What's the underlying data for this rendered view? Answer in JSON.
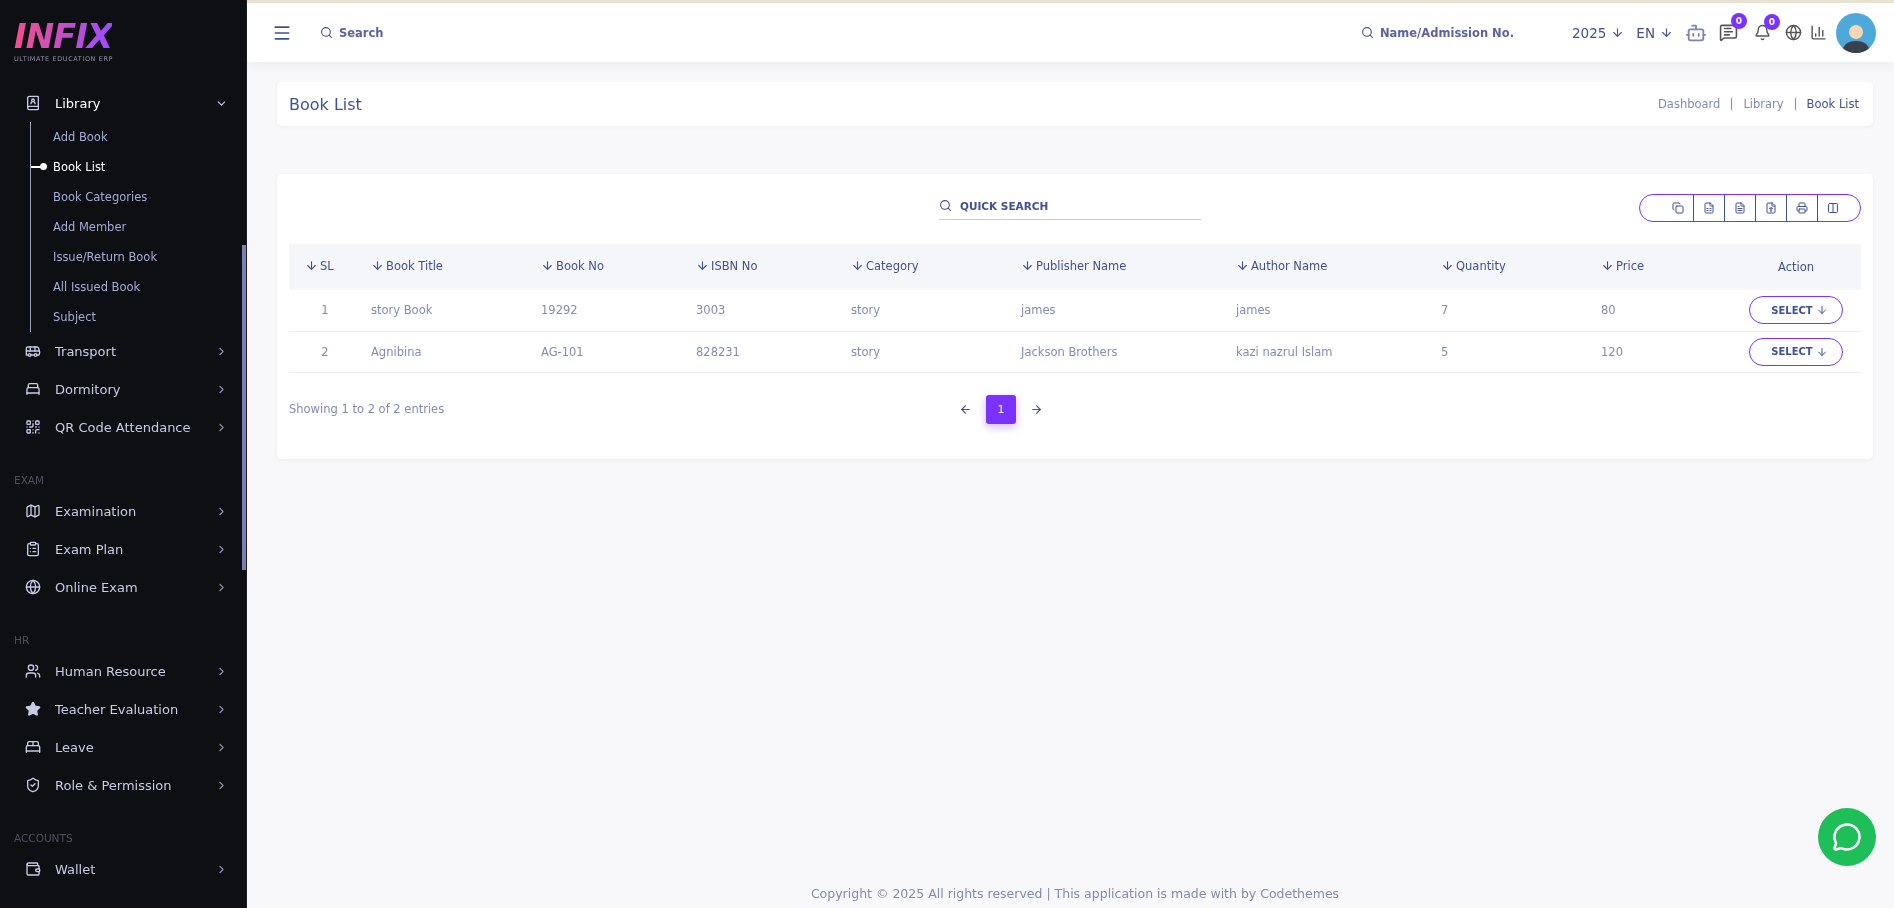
{
  "logo": {
    "name": "INFIX",
    "tagline": "ULTIMATE EDUCATION ERP"
  },
  "sidebar": {
    "sections": [
      {
        "items": [
          {
            "label": "Library",
            "expanded": true,
            "children": [
              {
                "label": "Add Book",
                "selected": false
              },
              {
                "label": "Book List",
                "selected": true
              },
              {
                "label": "Book Categories",
                "selected": false
              },
              {
                "label": "Add Member",
                "selected": false
              },
              {
                "label": "Issue/Return Book",
                "selected": false
              },
              {
                "label": "All Issued Book",
                "selected": false
              },
              {
                "label": "Subject",
                "selected": false
              }
            ]
          },
          {
            "label": "Transport",
            "expanded": false
          },
          {
            "label": "Dormitory",
            "expanded": false
          },
          {
            "label": "QR Code Attendance",
            "expanded": false
          }
        ]
      },
      {
        "heading": "EXAM",
        "items": [
          {
            "label": "Examination",
            "expanded": false
          },
          {
            "label": "Exam Plan",
            "expanded": false
          },
          {
            "label": "Online Exam",
            "expanded": false
          }
        ]
      },
      {
        "heading": "HR",
        "items": [
          {
            "label": "Human Resource",
            "expanded": false
          },
          {
            "label": "Teacher Evaluation",
            "expanded": false
          },
          {
            "label": "Leave",
            "expanded": false
          },
          {
            "label": "Role & Permission",
            "expanded": false
          }
        ]
      },
      {
        "heading": "ACCOUNTS",
        "items": [
          {
            "label": "Wallet",
            "expanded": false
          }
        ]
      }
    ]
  },
  "topbar": {
    "search": {
      "placeholder": "Search"
    },
    "student_search": {
      "placeholder": "Name/Admission No."
    },
    "year": "2025",
    "language": "EN",
    "messages_count": "0",
    "notifications_count": "0"
  },
  "page_header": {
    "title": "Book List",
    "breadcrumb": [
      "Dashboard",
      "Library",
      "Book List"
    ]
  },
  "table": {
    "quick_search": {
      "placeholder": "QUICK SEARCH"
    },
    "columns": [
      {
        "label": "SL",
        "sortable": true
      },
      {
        "label": "Book Title",
        "sortable": true
      },
      {
        "label": "Book No",
        "sortable": true
      },
      {
        "label": "ISBN No",
        "sortable": true
      },
      {
        "label": "Category",
        "sortable": true
      },
      {
        "label": "Publisher Name",
        "sortable": true
      },
      {
        "label": "Author Name",
        "sortable": true
      },
      {
        "label": "Quantity",
        "sortable": true
      },
      {
        "label": "Price",
        "sortable": true
      },
      {
        "label": "Action",
        "sortable": false
      }
    ],
    "rows": [
      {
        "cells": [
          "1",
          "story Book",
          "19292",
          "3003",
          "story",
          "james",
          "james",
          "7",
          "80"
        ],
        "action": "SELECT"
      },
      {
        "cells": [
          "2",
          "Agnibina",
          "AG-101",
          "828231",
          "story",
          "Jackson Brothers",
          "kazi nazrul Islam",
          "5",
          "120"
        ],
        "action": "SELECT"
      }
    ],
    "info": "Showing 1 to 2 of 2 entries",
    "pages": [
      {
        "label": "1",
        "selected": true
      }
    ]
  },
  "footer": {
    "text": "Copyright © 2025 All rights reserved | This application is made with by Codethemes"
  }
}
